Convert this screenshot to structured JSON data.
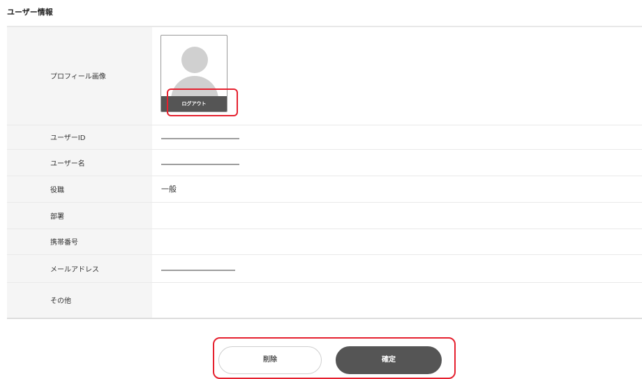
{
  "page": {
    "title": "ユーザー情報"
  },
  "profile": {
    "image_label": "プロフィール画像",
    "logout_label": "ログアウト",
    "avatar_icon": "user-silhouette-icon"
  },
  "fields": {
    "user_id": {
      "label": "ユーザーID",
      "value": "redacted"
    },
    "user_name": {
      "label": "ユーザー名",
      "value": "redacted"
    },
    "role": {
      "label": "役職",
      "value": "一般"
    },
    "department": {
      "label": "部署",
      "value": ""
    },
    "phone": {
      "label": "携帯番号",
      "value": ""
    },
    "email": {
      "label": "メールアドレス",
      "value": "redacted"
    },
    "other": {
      "label": "その他",
      "value": ""
    }
  },
  "actions": {
    "delete_label": "削除",
    "edit_label": "確定"
  },
  "colors": {
    "highlight": "#e5202e",
    "dark_button": "#555555",
    "label_bg": "#f5f5f5"
  }
}
